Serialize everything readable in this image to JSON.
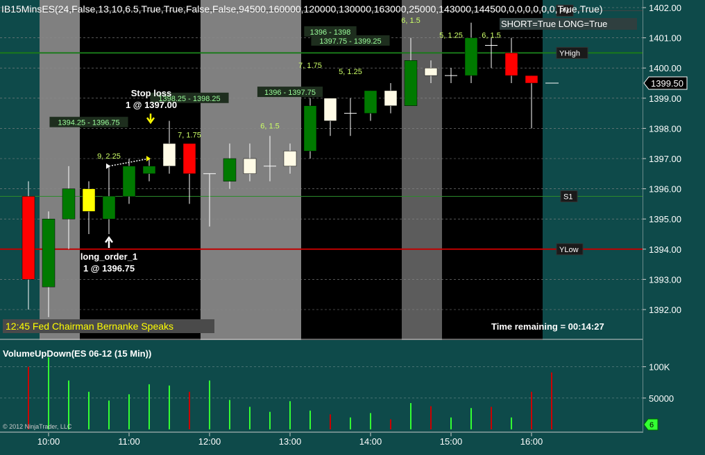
{
  "chart_data": [
    {
      "type": "candlestick",
      "title": "IB15MinsES(24,False,13,10,6.5,True,True,False,False,94500,160000,120000,130000,163000,25000,143000,144500,0,0,0,0,0,0,True,True)",
      "strategy_status": "SHORT=True LONG=True",
      "ylim": [
        1391.6,
        1402.1
      ],
      "y_ticks": [
        "1392.00",
        "1393.00",
        "1394.00",
        "1395.00",
        "1396.00",
        "1397.00",
        "1398.00",
        "1399.00",
        "1400.00",
        "1401.00",
        "1402.00"
      ],
      "last_price": "1399.50",
      "x_ticks": [
        "10:00",
        "11:00",
        "12:00",
        "13:00",
        "14:00",
        "15:00",
        "16:00"
      ],
      "candles": [
        {
          "t": "09:45",
          "o": 1393.0,
          "h": 1396.25,
          "l": 1392.0,
          "c": 1395.75,
          "color": "red"
        },
        {
          "t": "10:00",
          "o": 1392.75,
          "h": 1395.25,
          "l": 1391.75,
          "c": 1395.0,
          "color": "green"
        },
        {
          "t": "10:15",
          "o": 1395.0,
          "h": 1396.75,
          "l": 1394.0,
          "c": 1396.0,
          "color": "green"
        },
        {
          "t": "10:30",
          "o": 1396.0,
          "h": 1396.25,
          "l": 1394.5,
          "c": 1395.25,
          "color": "yellow"
        },
        {
          "t": "10:45",
          "o": 1395.0,
          "h": 1396.75,
          "l": 1394.5,
          "c": 1395.75,
          "color": "green"
        },
        {
          "t": "11:00",
          "o": 1395.75,
          "h": 1397.0,
          "l": 1395.5,
          "c": 1396.75,
          "color": "green"
        },
        {
          "t": "11:15",
          "o": 1396.5,
          "h": 1397.0,
          "l": 1396.25,
          "c": 1396.75,
          "color": "green"
        },
        {
          "t": "11:30",
          "o": 1396.75,
          "h": 1398.25,
          "l": 1396.5,
          "c": 1397.5,
          "color": "white"
        },
        {
          "t": "11:45",
          "o": 1397.5,
          "h": 1397.5,
          "l": 1395.5,
          "c": 1396.5,
          "color": "red"
        },
        {
          "t": "12:00",
          "o": 1396.5,
          "h": 1396.5,
          "l": 1394.75,
          "c": 1396.5,
          "color": "white"
        },
        {
          "t": "12:15",
          "o": 1396.25,
          "h": 1397.5,
          "l": 1396.0,
          "c": 1397.0,
          "color": "green"
        },
        {
          "t": "12:30",
          "o": 1396.5,
          "h": 1397.5,
          "l": 1396.25,
          "c": 1397.0,
          "color": "white"
        },
        {
          "t": "12:45",
          "o": 1396.75,
          "h": 1397.75,
          "l": 1396.25,
          "c": 1396.75,
          "color": "white"
        },
        {
          "t": "13:00",
          "o": 1396.75,
          "h": 1397.5,
          "l": 1396.5,
          "c": 1397.25,
          "color": "white"
        },
        {
          "t": "13:15",
          "o": 1397.25,
          "h": 1399.0,
          "l": 1397.0,
          "c": 1398.75,
          "color": "green"
        },
        {
          "t": "13:30",
          "o": 1398.25,
          "h": 1399.0,
          "l": 1397.75,
          "c": 1399.0,
          "color": "white"
        },
        {
          "t": "13:45",
          "o": 1398.5,
          "h": 1399.0,
          "l": 1397.75,
          "c": 1398.5,
          "color": "white"
        },
        {
          "t": "14:00",
          "o": 1398.5,
          "h": 1399.25,
          "l": 1398.25,
          "c": 1399.25,
          "color": "green"
        },
        {
          "t": "14:15",
          "o": 1398.75,
          "h": 1399.5,
          "l": 1398.5,
          "c": 1399.25,
          "color": "white"
        },
        {
          "t": "14:30",
          "o": 1398.75,
          "h": 1401.0,
          "l": 1398.75,
          "c": 1400.25,
          "color": "green"
        },
        {
          "t": "14:45",
          "o": 1399.75,
          "h": 1400.25,
          "l": 1399.5,
          "c": 1400.0,
          "color": "white"
        },
        {
          "t": "15:00",
          "o": 1399.75,
          "h": 1400.0,
          "l": 1399.5,
          "c": 1399.75,
          "color": "white"
        },
        {
          "t": "15:15",
          "o": 1399.75,
          "h": 1401.5,
          "l": 1399.5,
          "c": 1401.0,
          "color": "green"
        },
        {
          "t": "15:30",
          "o": 1400.75,
          "h": 1401.0,
          "l": 1400.0,
          "c": 1400.75,
          "color": "white"
        },
        {
          "t": "15:45",
          "o": 1400.5,
          "h": 1401.0,
          "l": 1399.5,
          "c": 1399.75,
          "color": "red"
        },
        {
          "t": "16:00",
          "o": 1399.75,
          "h": 1399.75,
          "l": 1398.0,
          "c": 1399.5,
          "color": "red"
        },
        {
          "t": "16:15",
          "o": 1399.5,
          "h": 1399.5,
          "l": 1399.5,
          "c": 1399.5,
          "color": "white"
        }
      ],
      "levels": [
        {
          "label": "PV",
          "price": 1401.9
        },
        {
          "label": "YHigh",
          "price": 1400.5
        },
        {
          "label": "S1",
          "price": 1395.75
        },
        {
          "label": "YLow",
          "price": 1394.0
        }
      ],
      "range_labels": [
        {
          "text": "1394.25 - 1396.75",
          "at": "10:30",
          "price": 1398.2
        },
        {
          "text": "1398.25 - 1398.25",
          "at": "11:45",
          "price": 1399.0
        },
        {
          "text": "1396 - 1397.75",
          "at": "13:00",
          "price": 1399.2
        },
        {
          "text": "1396 - 1398",
          "at": "13:30",
          "price": 1401.2
        },
        {
          "text": "1397.75 - 1399.25",
          "at": "13:45",
          "price": 1400.9
        }
      ],
      "bar_labels": [
        {
          "text": "9, 2.25",
          "at": "10:45",
          "price": 1397.0
        },
        {
          "text": "7, 1.75",
          "at": "11:45",
          "price": 1397.7
        },
        {
          "text": "6, 1.5",
          "at": "12:45",
          "price": 1398.0
        },
        {
          "text": "7, 1.75",
          "at": "13:15",
          "price": 1400.0
        },
        {
          "text": "5, 1.25",
          "at": "13:45",
          "price": 1399.8
        },
        {
          "text": "6, 1.5",
          "at": "14:30",
          "price": 1401.5
        },
        {
          "text": "5, 1.25",
          "at": "15:00",
          "price": 1401.0
        },
        {
          "text": "6, 1.5",
          "at": "15:30",
          "price": 1401.0
        }
      ],
      "orders": [
        {
          "name": "Stop loss",
          "detail": "1 @ 1397.00",
          "at": "11:15",
          "price": 1397.0
        },
        {
          "name": "long_order_1",
          "detail": "1 @ 1396.75",
          "at": "10:45",
          "price": 1396.75
        }
      ],
      "session_note": "12:45 Fed Chairman Bernanke Speaks",
      "time_remaining": "Time remaining = 00:14:27"
    },
    {
      "type": "bar",
      "title": "VolumeUpDown(ES 06-12 (15 Min))",
      "ylim": [
        0,
        115000
      ],
      "y_ticks": [
        "100K",
        "50000"
      ],
      "last_value_badge": "6",
      "values": [
        {
          "t": "09:45",
          "v": 100000,
          "color": "red"
        },
        {
          "t": "10:00",
          "v": 115000,
          "color": "green"
        },
        {
          "t": "10:15",
          "v": 78000,
          "color": "green"
        },
        {
          "t": "10:30",
          "v": 60000,
          "color": "green"
        },
        {
          "t": "10:45",
          "v": 46000,
          "color": "green"
        },
        {
          "t": "11:00",
          "v": 56000,
          "color": "green"
        },
        {
          "t": "11:15",
          "v": 72000,
          "color": "green"
        },
        {
          "t": "11:30",
          "v": 70000,
          "color": "green"
        },
        {
          "t": "11:45",
          "v": 60000,
          "color": "red"
        },
        {
          "t": "12:00",
          "v": 78000,
          "color": "green"
        },
        {
          "t": "12:15",
          "v": 47000,
          "color": "green"
        },
        {
          "t": "12:30",
          "v": 36000,
          "color": "green"
        },
        {
          "t": "12:45",
          "v": 28000,
          "color": "green"
        },
        {
          "t": "13:00",
          "v": 45000,
          "color": "green"
        },
        {
          "t": "13:15",
          "v": 30000,
          "color": "green"
        },
        {
          "t": "13:30",
          "v": 24000,
          "color": "red"
        },
        {
          "t": "13:45",
          "v": 19000,
          "color": "green"
        },
        {
          "t": "14:00",
          "v": 26000,
          "color": "green"
        },
        {
          "t": "14:15",
          "v": 16000,
          "color": "red"
        },
        {
          "t": "14:30",
          "v": 42000,
          "color": "green"
        },
        {
          "t": "14:45",
          "v": 37000,
          "color": "red"
        },
        {
          "t": "15:00",
          "v": 19000,
          "color": "green"
        },
        {
          "t": "15:15",
          "v": 34000,
          "color": "green"
        },
        {
          "t": "15:30",
          "v": 36000,
          "color": "red"
        },
        {
          "t": "15:45",
          "v": 19000,
          "color": "green"
        },
        {
          "t": "16:00",
          "v": 60000,
          "color": "red"
        },
        {
          "t": "16:15",
          "v": 91000,
          "color": "red"
        }
      ]
    }
  ],
  "copyright": "© 2012 NinjaTrader, LLC",
  "colors": {
    "bg": "#0e4a4a",
    "green_candle": "#007a00",
    "red_candle": "#ff0000",
    "white_candle": "#fffbe6",
    "yellow_candle": "#ffff00",
    "vol_green": "#33ff33",
    "vol_red": "#cc0000",
    "yhigh_line": "#1a7a1a",
    "ylow_line": "#c00000"
  }
}
